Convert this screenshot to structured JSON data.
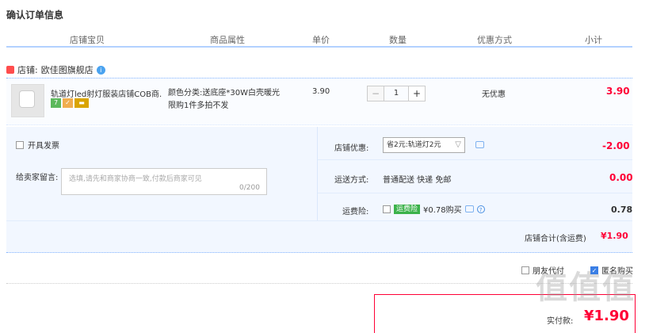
{
  "page": {
    "title": "确认订单信息"
  },
  "columns": [
    "店铺宝贝",
    "商品属性",
    "单价",
    "数量",
    "优惠方式",
    "小计"
  ],
  "store": {
    "prefix": "店铺:",
    "name": "欧佳图旗舰店",
    "chat_badge": "i"
  },
  "item": {
    "name": "轨道灯led射灯服装店铺COB商...",
    "badges": [
      "7",
      "✓",
      "▬"
    ],
    "attr_line1": "颜色分类:送底座*30W白壳暖光",
    "attr_line2": "限购1件多拍不发",
    "price": "3.90",
    "qty": "1",
    "minus": "−",
    "plus": "+",
    "promo": "无优惠",
    "subtotal": "3.90"
  },
  "invoice": {
    "label": "开具发票"
  },
  "message": {
    "label": "给卖家留言:",
    "placeholder": "选填,请先和商家协商一致,付款后商家可见",
    "count": "0/200"
  },
  "store_discount": {
    "label": "店铺优惠:",
    "selected": "省2元:轨道灯2元",
    "caret": "▽",
    "amount": "-2.00"
  },
  "shipping": {
    "label": "运送方式:",
    "method": "普通配送 快递 免邮",
    "fee": "0.00"
  },
  "insurance": {
    "label": "运费险:",
    "badge": "运费险",
    "text": "¥0.78购买",
    "help": "?",
    "fee": "0.78"
  },
  "total": {
    "label": "店铺合计(含运费)",
    "value": "¥1.90"
  },
  "options": {
    "friend_pay": "朋友代付",
    "anonymous": "匿名购买",
    "check_mark": "✓"
  },
  "final": {
    "label": "实付款:",
    "value": "¥1.90"
  },
  "watermark": "值值值"
}
